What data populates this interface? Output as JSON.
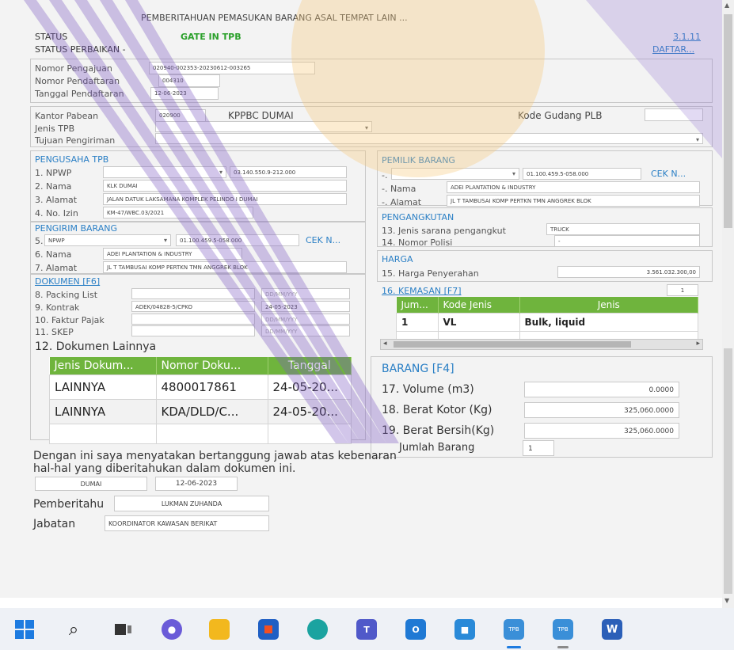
{
  "window": {
    "title": "PEMBERITAHUAN PEMASUKAN BARANG ASAL TEMPAT LAIN ..."
  },
  "status": {
    "label": "STATUS",
    "value": "GATE IN TPB",
    "perbaikan_label": "STATUS PERBAIKAN -",
    "version": "3.1.11",
    "daftar_link": "DAFTAR..."
  },
  "pengajuan": {
    "nomor_pengajuan_label": "Nomor Pengajuan",
    "nomor_pengajuan": "020940-002353-20230612-003265",
    "nomor_pendaftaran_label": "Nomor Pendaftaran",
    "nomor_pendaftaran": "004310",
    "tanggal_pendaftaran_label": "Tanggal Pendaftaran",
    "tanggal_pendaftaran": "12-06-2023"
  },
  "kantor": {
    "kantor_pabean_label": "Kantor Pabean",
    "kantor_kode": "020900",
    "kantor_nama": "KPPBC DUMAI",
    "kode_gudang_label": "Kode Gudang PLB",
    "jenis_tpb_label": "Jenis TPB",
    "tujuan_label": "Tujuan Pengiriman"
  },
  "pengusaha": {
    "header": "PENGUSAHA TPB",
    "npwp_label": "1. NPWP",
    "npwp": "03.140.550.9-212.000",
    "nama_label": "2. Nama",
    "nama": "KLK DUMAI",
    "alamat_label": "3. Alamat",
    "alamat": "JALAN DATUK LAKSAMANA KOMPLEK PELINDO I DUMAI",
    "izin_label": "4. No. Izin",
    "izin": "KM-47/WBC.03/2021"
  },
  "pengirim": {
    "header": "PENGIRIM BARANG",
    "npwp_label": "5.",
    "npwp_type": "NPWP",
    "npwp": "01.100.459.5-058.000",
    "cek": "CEK N...",
    "nama_label": "6. Nama",
    "nama": "ADEI PLANTATION & INDUSTRY",
    "alamat_label": "7. Alamat",
    "alamat": "JL T TAMBUSAI KOMP PERTKN TMN ANGGREK BLOK"
  },
  "pemilik": {
    "header": "PEMILIK BARANG",
    "npwp_label": "-.",
    "npwp": "01.100.459.5-058.000",
    "cek": "CEK N...",
    "nama_label": "-. Nama",
    "nama": "ADEI PLANTATION & INDUSTRY",
    "alamat_label": "-. Alamat",
    "alamat": "JL T TAMBUSAI KOMP PERTKN TMN ANGGREK BLOK"
  },
  "pengangkutan": {
    "header": "PENGANGKUTAN",
    "jenis_label": "13. Jenis sarana pengangkut",
    "jenis": "TRUCK",
    "polisi_label": "14. Nomor Polisi",
    "polisi": "-"
  },
  "harga": {
    "header": "HARGA",
    "penyerahan_label": "15. Harga Penyerahan",
    "penyerahan": "3.561.032.300,00"
  },
  "kemasan": {
    "header": "16. KEMASAN [F7]",
    "count": "1",
    "columns": [
      "Jum...",
      "Kode Jenis",
      "Jenis"
    ],
    "rows": [
      [
        "1",
        "VL",
        "Bulk, liquid"
      ]
    ]
  },
  "dokumen": {
    "header": "DOKUMEN [F6]",
    "packing_label": "8. Packing List",
    "packing_date": "DD/MM/YYY",
    "kontrak_label": "9. Kontrak",
    "kontrak_no": "ADEK/04828-5/CPKO",
    "kontrak_date": "24-05-2023",
    "faktur_label": "10. Faktur Pajak",
    "faktur_date": "DD/MM/YYY",
    "skep_label": "11. SKEP",
    "skep_date": "DD/MM/YYY",
    "lainnya_label": "12. Dokumen Lainnya",
    "columns": [
      "Jenis Dokum...",
      "Nomor Doku...",
      "Tanggal"
    ],
    "rows": [
      [
        "LAINNYA",
        "4800017861",
        "24-05-20..."
      ],
      [
        "LAINNYA",
        "KDA/DLD/C...",
        "24-05-20..."
      ]
    ]
  },
  "barang": {
    "header": "BARANG [F4]",
    "volume_label": "17. Volume (m3)",
    "volume": "0.0000",
    "bruto_label": "18. Berat Kotor (Kg)",
    "bruto": "325,060.0000",
    "netto_label": "19. Berat Bersih(Kg)",
    "netto": "325,060.0000",
    "jumlah_label": "Jumlah Barang",
    "jumlah": "1"
  },
  "pernyataan": {
    "text_line1": "Dengan ini saya menyatakan bertanggung jawab atas kebenaran",
    "text_line2": "hal-hal yang diberitahukan dalam dokumen ini.",
    "kota": "DUMAI",
    "tanggal": "12-06-2023",
    "pemberitahu_label": "Pemberitahu",
    "pemberitahu": "LUKMAN ZUHANDA",
    "jabatan_label": "Jabatan",
    "jabatan": "KOORDINATOR KAWASAN BERIKAT"
  },
  "taskbar": {
    "icons": [
      "windows-start-icon",
      "search-icon",
      "task-view-icon",
      "chat-icon",
      "file-explorer-icon",
      "store-icon",
      "edge-icon",
      "teams-icon",
      "outlook-icon",
      "app-icon",
      "tpb-app-icon",
      "tpb-app-icon-2",
      "word-icon"
    ],
    "labels": {
      "tpb1": "TPB",
      "tpb2": "TPB",
      "word": "W"
    }
  }
}
